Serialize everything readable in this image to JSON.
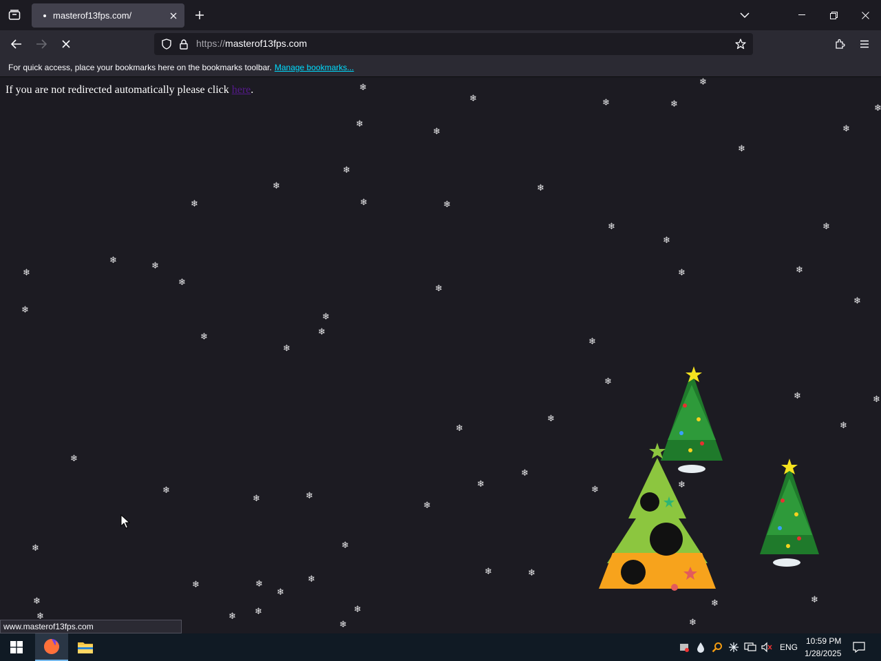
{
  "browser": {
    "tab": {
      "title": "masterof13fps.com/"
    },
    "url": {
      "scheme": "https://",
      "host": "masterof13fps.com"
    },
    "bookmarks_bar": {
      "message": "For quick access, place your bookmarks here on the bookmarks toolbar.",
      "link": "Manage bookmarks..."
    },
    "status_url": "www.masterof13fps.com"
  },
  "page": {
    "redirect_text": "If you are not redirected automatically please click",
    "redirect_link": "here",
    "redirect_end": ".",
    "snowflake_glyph": "❄"
  },
  "taskbar": {
    "language": "ENG",
    "time": "10:59 PM",
    "date": "1/28/2025"
  },
  "colors": {
    "accent_link": "#00ddff",
    "visited_link": "#551a8b",
    "page_bg": "#1c1b22"
  },
  "icons": [
    "tab-list-icon",
    "close-icon",
    "plus-icon",
    "chevron-down-icon",
    "minimize-icon",
    "restore-icon",
    "back-icon",
    "forward-icon",
    "stop-icon",
    "shield-icon",
    "lock-icon",
    "star-icon",
    "extensions-icon",
    "menu-icon",
    "windows-start-icon",
    "firefox-icon",
    "file-explorer-icon",
    "notification-icon"
  ]
}
